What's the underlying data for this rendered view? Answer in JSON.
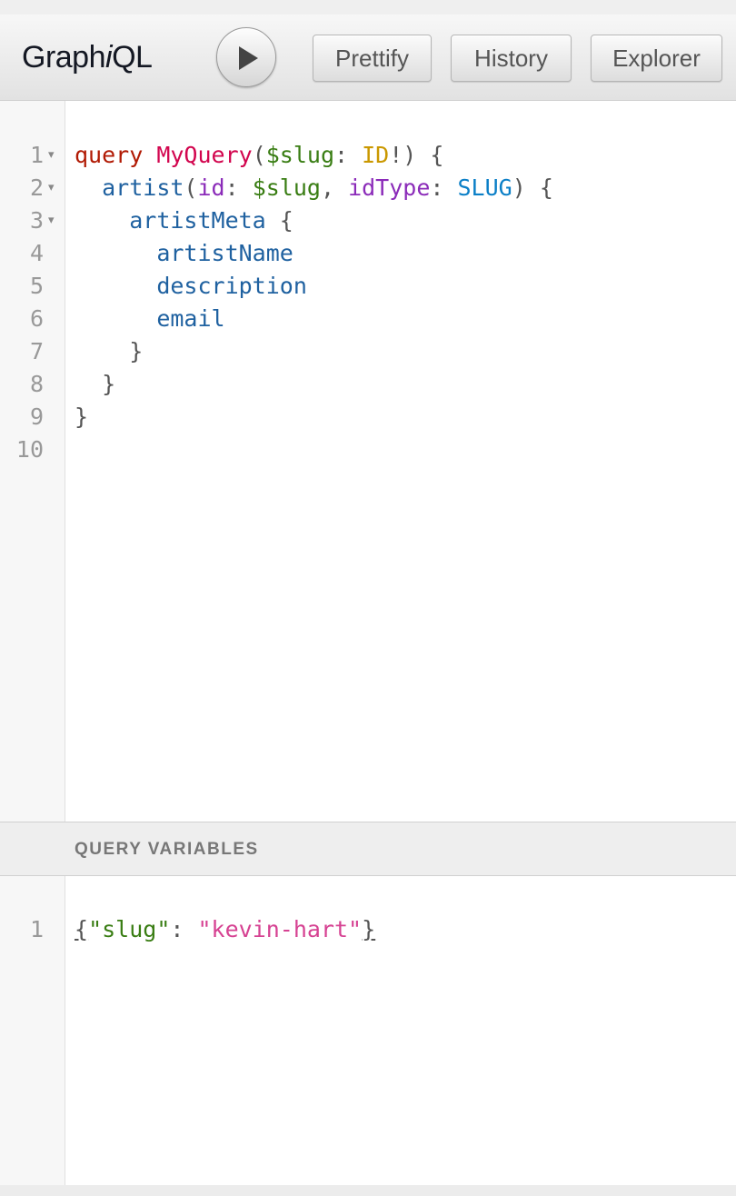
{
  "app": {
    "title_plain": "Graph",
    "title_italic": "i",
    "title_tail": "QL"
  },
  "toolbar": {
    "run_icon": "play-icon",
    "prettify_label": "Prettify",
    "history_label": "History",
    "explorer_label": "Explorer"
  },
  "query_editor": {
    "line_numbers": [
      "1",
      "2",
      "3",
      "4",
      "5",
      "6",
      "7",
      "8",
      "9",
      "10"
    ],
    "fold_markers": [
      "▾",
      "▾",
      "▾"
    ],
    "tokens": {
      "l1_kw": "query",
      "l1_name": "MyQuery",
      "l1_open": "(",
      "l1_var": "$slug",
      "l1_colon": ": ",
      "l1_type": "ID",
      "l1_bang": "!",
      "l1_close": ") {",
      "l2_field": "artist",
      "l2_open": "(",
      "l2_arg1": "id",
      "l2_colon1": ": ",
      "l2_var": "$slug",
      "l2_comma": ", ",
      "l2_arg2": "idType",
      "l2_colon2": ": ",
      "l2_enum": "SLUG",
      "l2_close": ") {",
      "l3_field": "artistMeta",
      "l3_brace": " {",
      "l4_field": "artistName",
      "l5_field": "description",
      "l6_field": "email",
      "l7_brace": "}",
      "l8_brace": "}",
      "l9_brace": "}"
    }
  },
  "variables_panel": {
    "header": "QUERY VARIABLES",
    "line_numbers": [
      "1"
    ],
    "tokens": {
      "open": "{",
      "key": "\"slug\"",
      "colon": ": ",
      "value": "\"kevin-hart\"",
      "close": "}"
    }
  }
}
